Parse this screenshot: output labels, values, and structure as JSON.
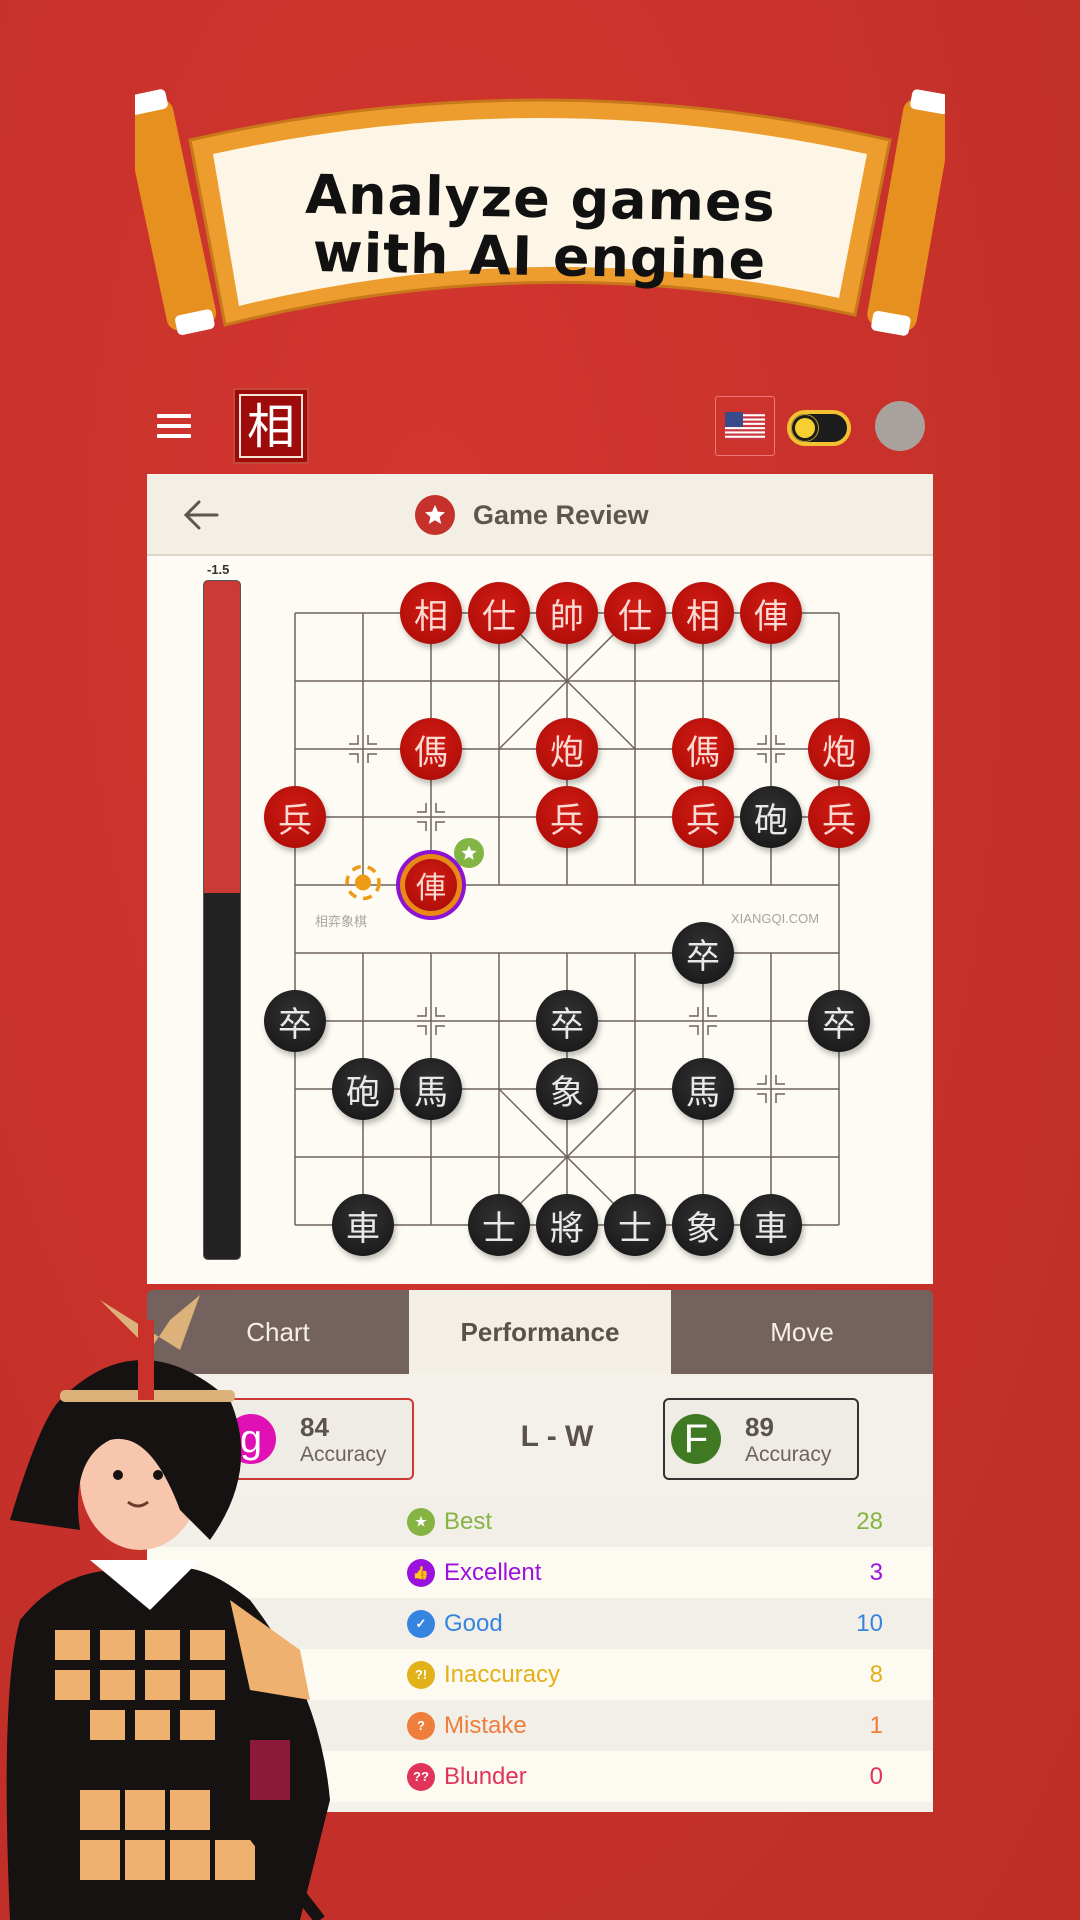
{
  "banner": {
    "line1": "Analyze games",
    "line2": "with AI engine"
  },
  "header": {
    "menu_icon": "hamburger-menu-icon",
    "logo_char": "相",
    "language_flag": "us-flag-icon",
    "theme_toggle_state": "dark",
    "avatar_icon": "user-avatar-icon"
  },
  "review": {
    "back_icon": "arrow-left-icon",
    "title_icon": "star-badge-icon",
    "title": "Game Review"
  },
  "evaluation": {
    "score_label": "-1.5",
    "red_fraction": 0.46,
    "colors": {
      "red": "#cb3a36",
      "black": "#222222"
    }
  },
  "board": {
    "watermark_left": "相弈象棋",
    "watermark_right": "XIANGQI.COM",
    "pieces": [
      {
        "side": "red",
        "char": "相",
        "col": 2,
        "row": 0
      },
      {
        "side": "red",
        "char": "仕",
        "col": 3,
        "row": 0
      },
      {
        "side": "red",
        "char": "帥",
        "col": 4,
        "row": 0
      },
      {
        "side": "red",
        "char": "仕",
        "col": 5,
        "row": 0
      },
      {
        "side": "red",
        "char": "相",
        "col": 6,
        "row": 0
      },
      {
        "side": "red",
        "char": "俥",
        "col": 7,
        "row": 0
      },
      {
        "side": "red",
        "char": "傌",
        "col": 2,
        "row": 2
      },
      {
        "side": "red",
        "char": "炮",
        "col": 4,
        "row": 2
      },
      {
        "side": "red",
        "char": "傌",
        "col": 6,
        "row": 2
      },
      {
        "side": "red",
        "char": "炮",
        "col": 8,
        "row": 2
      },
      {
        "side": "red",
        "char": "兵",
        "col": 0,
        "row": 3
      },
      {
        "side": "red",
        "char": "兵",
        "col": 4,
        "row": 3
      },
      {
        "side": "red",
        "char": "兵",
        "col": 6,
        "row": 3
      },
      {
        "side": "black",
        "char": "砲",
        "col": 7,
        "row": 3
      },
      {
        "side": "red",
        "char": "兵",
        "col": 8,
        "row": 3
      },
      {
        "side": "red",
        "char": "俥",
        "col": 2,
        "row": 4,
        "selected": true
      },
      {
        "side": "black",
        "char": "卒",
        "col": 6,
        "row": 5
      },
      {
        "side": "black",
        "char": "卒",
        "col": 0,
        "row": 6
      },
      {
        "side": "black",
        "char": "卒",
        "col": 4,
        "row": 6
      },
      {
        "side": "black",
        "char": "卒",
        "col": 8,
        "row": 6
      },
      {
        "side": "black",
        "char": "砲",
        "col": 1,
        "row": 7
      },
      {
        "side": "black",
        "char": "馬",
        "col": 2,
        "row": 7
      },
      {
        "side": "black",
        "char": "象",
        "col": 4,
        "row": 7
      },
      {
        "side": "black",
        "char": "馬",
        "col": 6,
        "row": 7
      },
      {
        "side": "black",
        "char": "車",
        "col": 1,
        "row": 9
      },
      {
        "side": "black",
        "char": "士",
        "col": 3,
        "row": 9
      },
      {
        "side": "black",
        "char": "將",
        "col": 4,
        "row": 9
      },
      {
        "side": "black",
        "char": "士",
        "col": 5,
        "row": 9
      },
      {
        "side": "black",
        "char": "象",
        "col": 6,
        "row": 9
      },
      {
        "side": "black",
        "char": "車",
        "col": 7,
        "row": 9
      }
    ],
    "best_move_marker": {
      "icon": "star-icon",
      "col": 2,
      "row": 4,
      "color": "#82b543"
    },
    "last_move_origin": {
      "icon": "hint-dot-icon",
      "col": 1,
      "row": 4,
      "color": "#ed9b15"
    },
    "markers": [
      {
        "col": 1,
        "row": 2
      },
      {
        "col": 7,
        "row": 2
      },
      {
        "col": 2,
        "row": 3
      },
      {
        "col": 2,
        "row": 6
      },
      {
        "col": 6,
        "row": 6
      },
      {
        "col": 7,
        "row": 7
      }
    ]
  },
  "tabs": [
    {
      "label": "Chart",
      "active": false
    },
    {
      "label": "Performance",
      "active": true
    },
    {
      "label": "Move",
      "active": false
    }
  ],
  "performance": {
    "player_left": {
      "initial": "g",
      "color": "#e010b4",
      "accuracy": "84",
      "label": "Accuracy"
    },
    "result": "L - W",
    "player_right": {
      "initial": "F",
      "color": "#3f7a22",
      "accuracy": "89",
      "label": "Accuracy"
    },
    "stats": [
      {
        "label": "Best",
        "value": "28",
        "icon": "star-icon",
        "glyph": "★",
        "color": "#86b443"
      },
      {
        "label": "Excellent",
        "value": "3",
        "icon": "thumbs-up-icon",
        "glyph": "👍",
        "color": "#9b11de"
      },
      {
        "label": "Good",
        "value": "10",
        "icon": "check-icon",
        "glyph": "✓",
        "color": "#3585e0"
      },
      {
        "label": "Inaccuracy",
        "value": "8",
        "icon": "inaccuracy-icon",
        "glyph": "?!",
        "color": "#e2b018"
      },
      {
        "label": "Mistake",
        "value": "1",
        "icon": "question-icon",
        "glyph": "?",
        "color": "#ef7d3c"
      },
      {
        "label": "Blunder",
        "value": "0",
        "icon": "double-question-icon",
        "glyph": "??",
        "color": "#e0345a"
      }
    ]
  }
}
